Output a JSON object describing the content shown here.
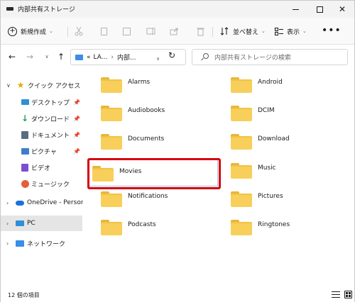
{
  "window": {
    "title": "内部共有ストレージ",
    "minimize_glyph": "—",
    "maximize_glyph": "☐",
    "close_glyph": "✕"
  },
  "toolbar": {
    "new_label": "新規作成",
    "sort_label": "並べ替え",
    "view_label": "表示",
    "more_label": "•••"
  },
  "address": {
    "prefix": "«",
    "crumbs": [
      "LA...",
      "内部..."
    ]
  },
  "search": {
    "placeholder": "内部共有ストレージの検索"
  },
  "sidebar": {
    "items": [
      {
        "label": "クイック アクセス",
        "icon": "star-icon",
        "expanded": true
      },
      {
        "label": "デスクトップ",
        "icon": "desktop-icon",
        "pinned": true
      },
      {
        "label": "ダウンロード",
        "icon": "download-icon",
        "pinned": true
      },
      {
        "label": "ドキュメント",
        "icon": "document-icon",
        "pinned": true
      },
      {
        "label": "ピクチャ",
        "icon": "picture-icon",
        "pinned": true
      },
      {
        "label": "ビデオ",
        "icon": "video-icon"
      },
      {
        "label": "ミュージック",
        "icon": "music-icon"
      },
      {
        "label": "OneDrive - Personal",
        "icon": "cloud-icon"
      },
      {
        "label": "PC",
        "icon": "pc-icon",
        "selected": true
      },
      {
        "label": "ネットワーク",
        "icon": "network-icon"
      }
    ]
  },
  "folders": [
    "Alarms",
    "Android",
    "Audiobooks",
    "DCIM",
    "Documents",
    "Download",
    "Movies",
    "Music",
    "Notifications",
    "Pictures",
    "Podcasts",
    "Ringtones"
  ],
  "highlighted_folder": "Movies",
  "status": {
    "item_count": "12 個の項目"
  },
  "colors": {
    "folder": "#f7cf5a",
    "highlight_box": "#d7000f",
    "selection": "#e5e5e5",
    "accent": "#3a8ee6"
  }
}
